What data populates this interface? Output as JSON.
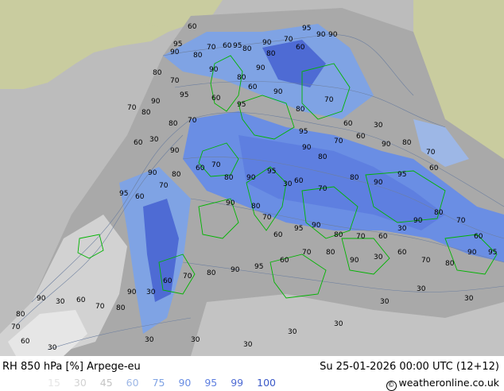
{
  "title": {
    "left": "RH 850 hPa [%] Arpege-eu",
    "right": "Su 25-01-2026 00:00 UTC (12+12)"
  },
  "legend": {
    "levels": [
      "15",
      "30",
      "45",
      "60",
      "75",
      "90",
      "95",
      "99",
      "100"
    ],
    "colors": [
      "#e6e6e6",
      "#d2d2d2",
      "#c3c3c3",
      "#9db7e6",
      "#7fa3e4",
      "#6a8ee4",
      "#5e7fe0",
      "#4e6bd4",
      "#3b59c8"
    ]
  },
  "credit": "weatheronline.co.uk",
  "colors": {
    "outside": "#bcbcbc",
    "land_outside": "#c9cc9f",
    "border": "#00b400"
  },
  "contour_labels": [
    "60",
    "95",
    "90",
    "80",
    "70",
    "60",
    "95",
    "90",
    "80",
    "70",
    "60",
    "95",
    "90",
    "90",
    "80",
    "90",
    "80",
    "60",
    "90",
    "80",
    "70",
    "95",
    "90",
    "80",
    "70",
    "60",
    "30",
    "90",
    "80",
    "70",
    "60",
    "95",
    "90",
    "80",
    "70",
    "60",
    "95",
    "90",
    "80",
    "70",
    "60",
    "30",
    "95",
    "90",
    "80",
    "70",
    "60",
    "90",
    "80",
    "70",
    "60",
    "95",
    "90",
    "80",
    "70",
    "60",
    "95",
    "90",
    "80",
    "70",
    "60",
    "30",
    "90",
    "80",
    "70",
    "60",
    "95",
    "90",
    "80",
    "70",
    "60",
    "30",
    "90",
    "80",
    "70",
    "60",
    "95",
    "90",
    "80",
    "70",
    "60",
    "30",
    "90",
    "80",
    "70",
    "60",
    "95",
    "90",
    "80",
    "70",
    "60",
    "30",
    "90",
    "80",
    "70",
    "60",
    "30",
    "90",
    "80",
    "70",
    "60",
    "30",
    "30",
    "30",
    "30",
    "30",
    "30",
    "30",
    "30",
    "30"
  ]
}
